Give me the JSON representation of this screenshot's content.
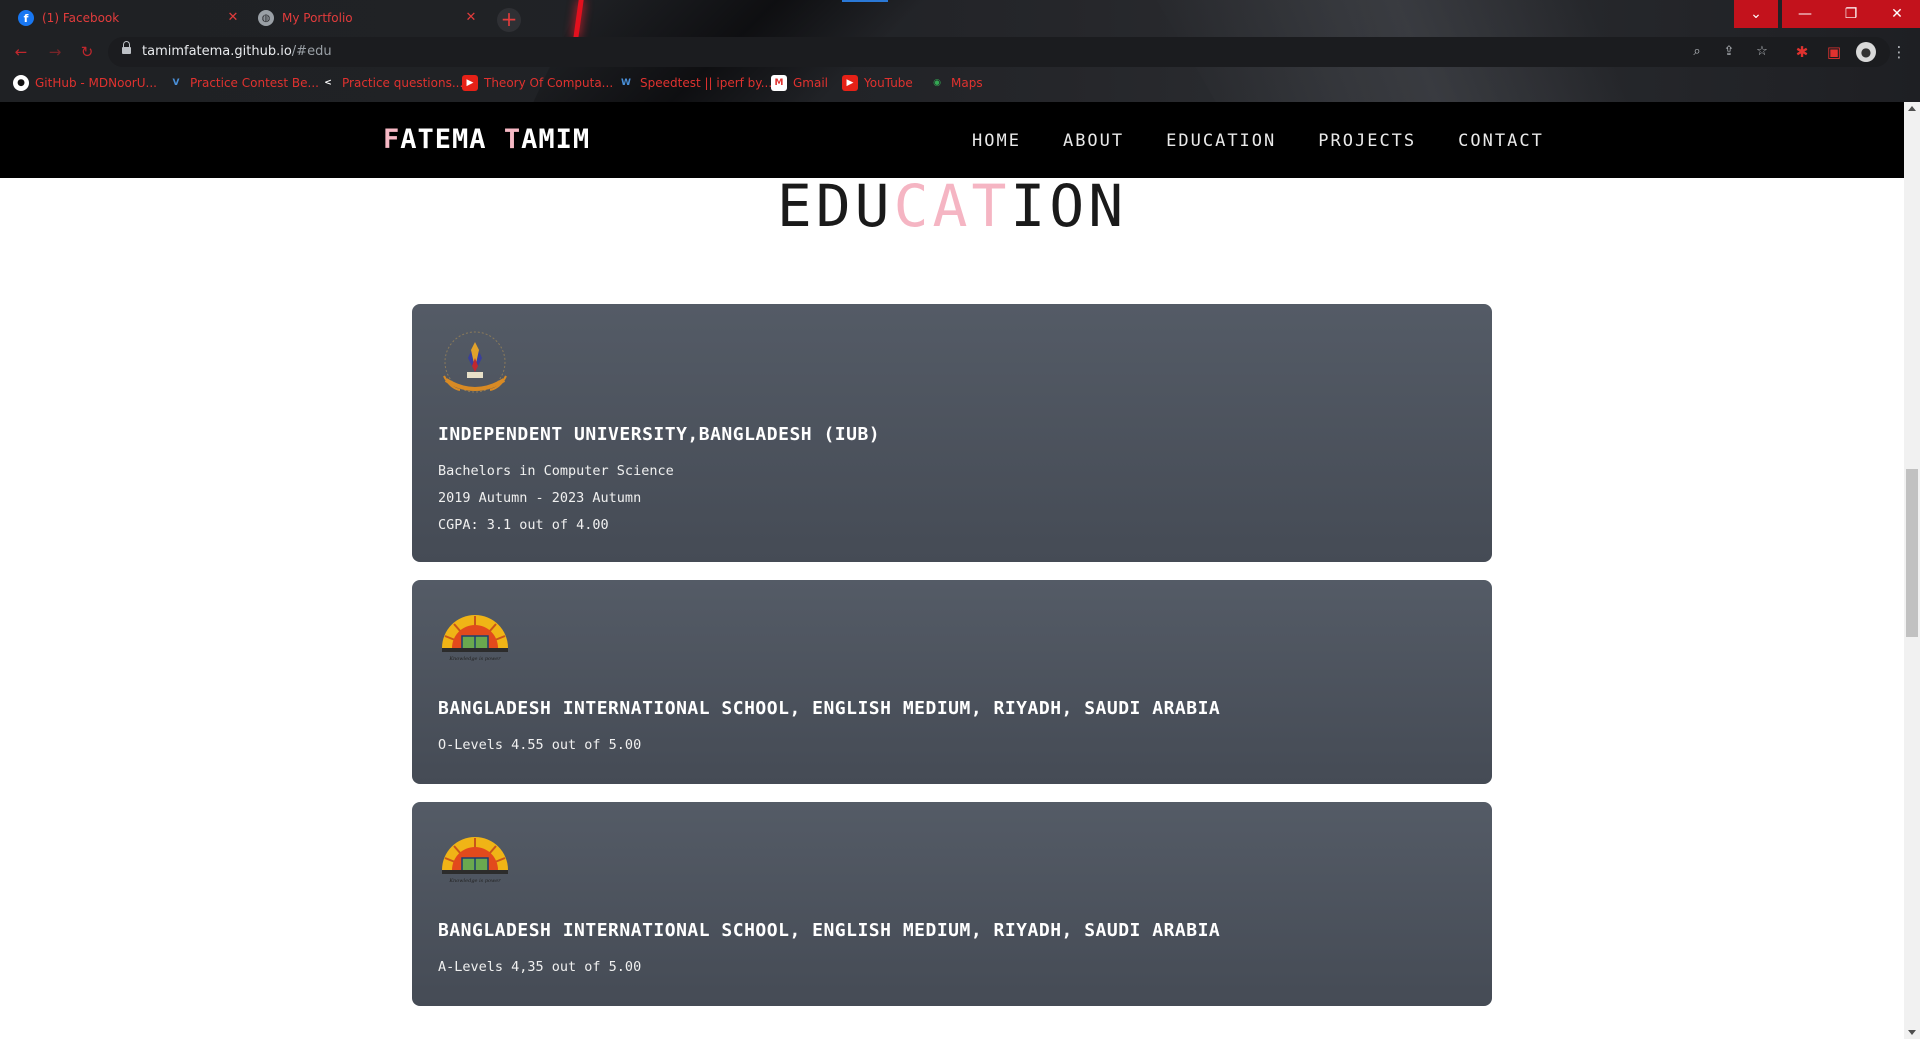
{
  "browser": {
    "tabs": [
      {
        "title": "(1) Facebook",
        "icon": "facebook-icon"
      },
      {
        "title": "My Portfolio",
        "icon": "globe-icon"
      }
    ],
    "url_host": "tamimfatema.github.io",
    "url_path": "/#edu",
    "bookmarks": [
      {
        "label": "GitHub - MDNoorU...",
        "icon": "github-icon"
      },
      {
        "label": "Practice Contest Be...",
        "icon": "vjudge-icon"
      },
      {
        "label": "Practice questions...",
        "icon": "code-bracket-icon"
      },
      {
        "label": "Theory Of Computa...",
        "icon": "youtube-icon"
      },
      {
        "label": "Speedtest || iperf by...",
        "icon": "speedtest-icon"
      },
      {
        "label": "Gmail",
        "icon": "gmail-icon"
      },
      {
        "label": "YouTube",
        "icon": "youtube-icon"
      },
      {
        "label": "Maps",
        "icon": "maps-icon"
      }
    ],
    "accent_color": "#c3121c"
  },
  "site": {
    "brand_first": "F",
    "brand_mid": "ATEMA ",
    "brand_t": "T",
    "brand_rest": "AMIM",
    "nav": [
      "HOME",
      "ABOUT",
      "EDUCATION",
      "PROJECTS",
      "CONTACT"
    ],
    "pink_accent": "#f5b5c3"
  },
  "education": {
    "title_part1": "EDU",
    "title_part2": "CAT",
    "title_part3": "ION",
    "entries": [
      {
        "school": "INDEPENDENT UNIVERSITY,BANGLADESH (IUB)",
        "logo": "iub-crest-logo",
        "lines": [
          "Bachelors in Computer Science",
          "2019 Autumn - 2023 Autumn",
          "CGPA: 3.1 out of 4.00"
        ]
      },
      {
        "school": "BANGLADESH INTERNATIONAL SCHOOL, ENGLISH MEDIUM, RIYADH, SAUDI ARABIA",
        "logo": "bis-sunburst-logo",
        "lines": [
          "O-Levels 4.55 out of 5.00"
        ]
      },
      {
        "school": "BANGLADESH INTERNATIONAL SCHOOL, ENGLISH MEDIUM, RIYADH, SAUDI ARABIA",
        "logo": "bis-sunburst-logo",
        "lines": [
          "A-Levels 4,35 out of 5.00"
        ]
      }
    ]
  }
}
